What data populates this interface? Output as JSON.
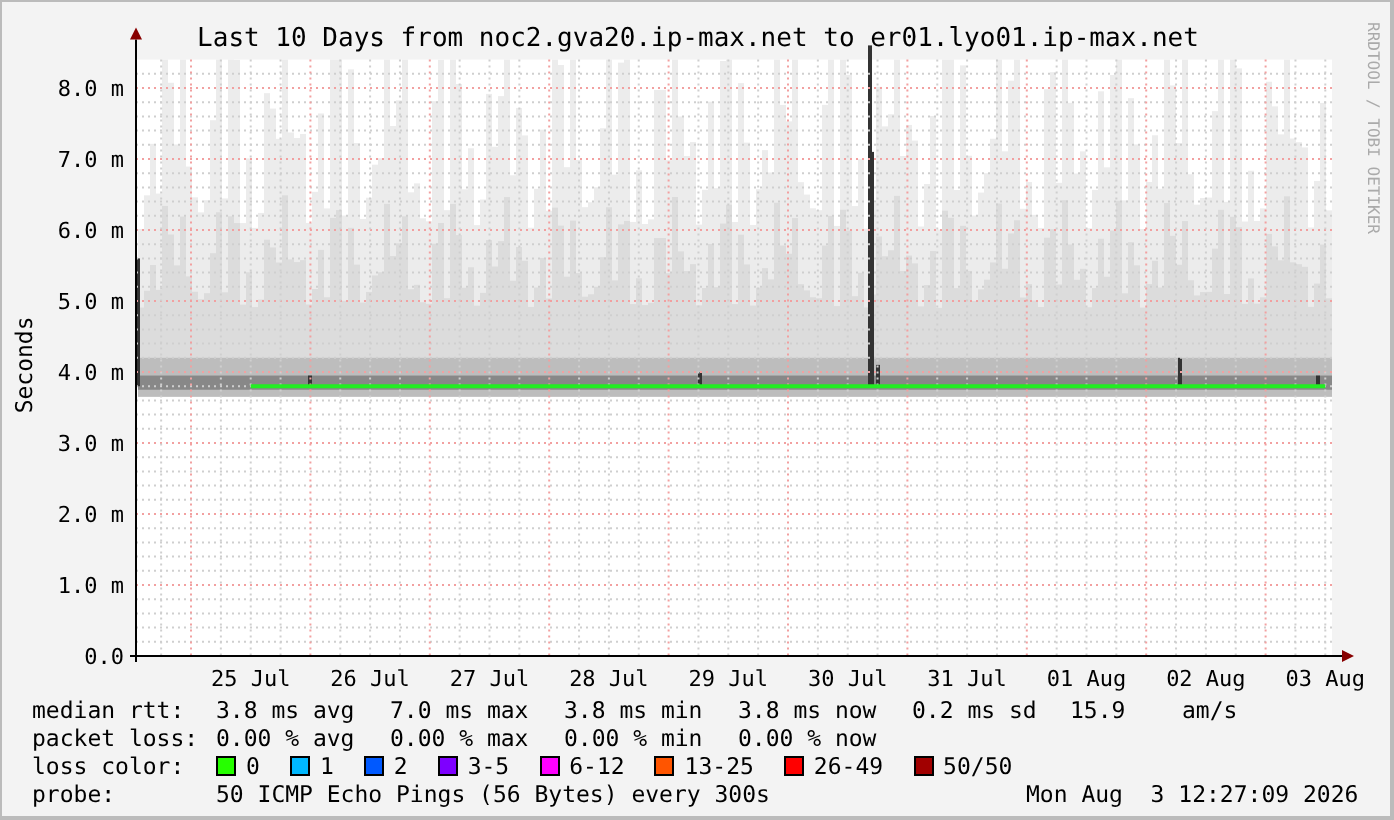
{
  "chart": {
    "title": "Last 10 Days from noc2.gva20.ip-max.net to er01.lyo01.ip-max.net",
    "side_note": "RRDTOOL / TOBI OETIKER",
    "chart_data": {
      "type": "line",
      "ylabel": "Seconds",
      "categories": [
        "25 Jul",
        "26 Jul",
        "27 Jul",
        "28 Jul",
        "29 Jul",
        "30 Jul",
        "31 Jul",
        "01 Aug",
        "02 Aug",
        "03 Aug"
      ],
      "ylim": [
        0,
        8.4
      ],
      "grid": true,
      "yticks": [
        {
          "value": 0,
          "label": "0.0"
        },
        {
          "value": 1,
          "label": "1.0 m"
        },
        {
          "value": 2,
          "label": "2.0 m"
        },
        {
          "value": 3,
          "label": "3.0 m"
        },
        {
          "value": 4,
          "label": "4.0 m"
        },
        {
          "value": 5,
          "label": "5.0 m"
        },
        {
          "value": 6,
          "label": "6.0 m"
        },
        {
          "value": 7,
          "label": "7.0 m"
        },
        {
          "value": 8,
          "label": "8.0 m"
        }
      ],
      "series": [
        {
          "color": "#22ee22",
          "values": [
            3.8,
            3.8,
            3.8,
            3.8,
            3.8,
            3.8,
            3.8,
            3.8,
            3.8,
            3.8
          ]
        }
      ]
    }
  },
  "legend": {
    "rows": [
      {
        "kind": "stats",
        "label": "median rtt:",
        "values": [
          "3.8 ms avg",
          "7.0 ms max",
          "3.8 ms min",
          "3.8 ms now",
          "0.2 ms sd",
          "15.9",
          "am/s"
        ]
      },
      {
        "kind": "stats",
        "label": "packet loss:",
        "values": [
          "0.00 % avg",
          "0.00 % max",
          "0.00 % min",
          "0.00 % now"
        ]
      },
      {
        "kind": "colors",
        "label": "loss color:",
        "items": [
          {
            "label": "0",
            "color": "#26ff00"
          },
          {
            "label": "1",
            "color": "#00b8ff"
          },
          {
            "label": "2",
            "color": "#0059ff"
          },
          {
            "label": "3-5",
            "color": "#7e00ff"
          },
          {
            "label": "6-12",
            "color": "#ff00ff"
          },
          {
            "label": "13-25",
            "color": "#ff5500"
          },
          {
            "label": "26-49",
            "color": "#ff0000"
          },
          {
            "label": "50/50",
            "color": "#a10000"
          }
        ]
      },
      {
        "kind": "probe",
        "label": "probe:",
        "text": "50 ICMP Echo Pings (56 Bytes) every 300s",
        "time": "Mon Aug  3 12:27:09 2026"
      }
    ]
  }
}
